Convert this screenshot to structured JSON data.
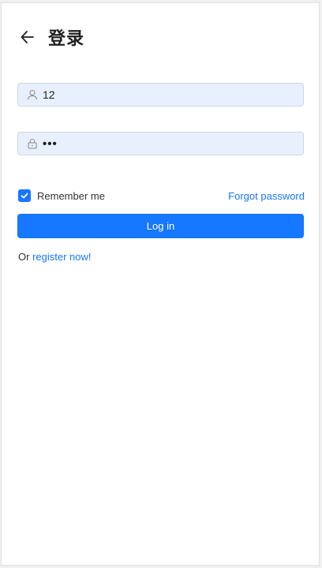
{
  "header": {
    "back_icon": "arrow-left-icon",
    "title": "登录"
  },
  "form": {
    "username": {
      "icon": "user-icon",
      "value": "12"
    },
    "password": {
      "icon": "lock-icon",
      "value": "•••"
    },
    "remember": {
      "checked": true,
      "label": "Remember me"
    },
    "forgot_link": "Forgot password",
    "login_button": "Log in",
    "register_prefix": "Or",
    "register_link": "register now!"
  },
  "colors": {
    "primary": "#1677ff",
    "input_bg": "#e8f0fe"
  }
}
